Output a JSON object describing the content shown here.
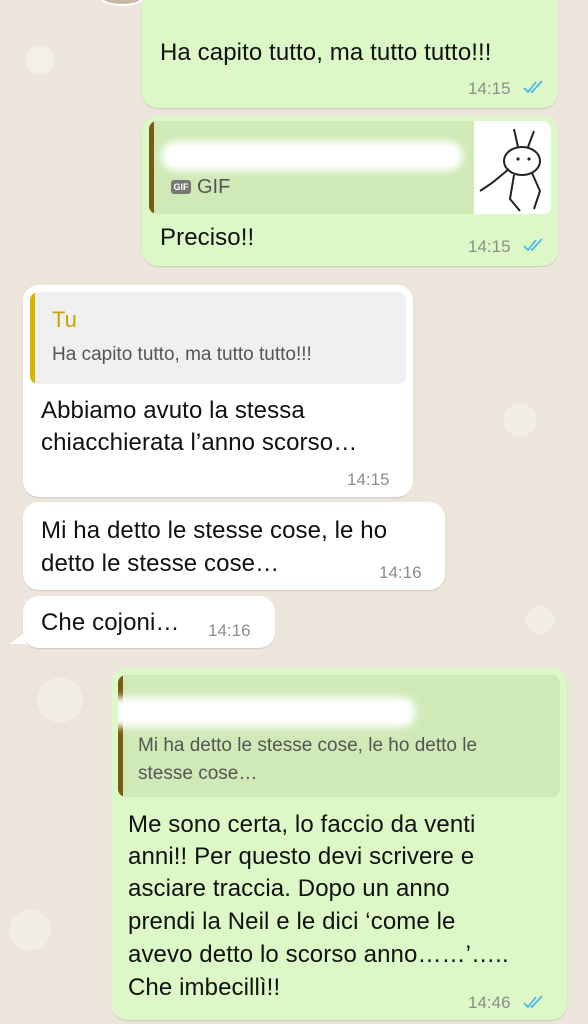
{
  "messages": {
    "m1": {
      "text": "Ha capito tutto, ma tutto tutto!!!",
      "time": "14:15",
      "status": "read"
    },
    "m2": {
      "reply_label": "GIF",
      "gif_badge": "GIF",
      "text": "Preciso!!",
      "time": "14:15",
      "status": "read"
    },
    "m3": {
      "reply_author": "Tu",
      "reply_text": "Ha capito tutto, ma tutto tutto!!!",
      "line1": "Abbiamo avuto la stessa",
      "line2": "chiacchierata l’anno scorso…",
      "time": "14:15"
    },
    "m4": {
      "line1": "Mi ha detto le stesse cose, le ho",
      "line2": "detto le stesse cose…",
      "time": "14:16"
    },
    "m5": {
      "text": "Che cojoni…",
      "time": "14:16"
    },
    "m6": {
      "reply_line1": "Mi ha detto le stesse cose, le ho detto le",
      "reply_line2": "stesse cose…",
      "line1": "Me sono certa, lo faccio da venti",
      "line2": "anni!! Per questo devi scrivere e",
      "line3": "asciare traccia. Dopo un anno",
      "line4": "prendi la Neil e le dici ‘come le",
      "line5": "avevo detto lo scorso anno……’…..",
      "line6": "Che imbecillì!!",
      "time": "14:46",
      "status": "read"
    }
  },
  "colors": {
    "outgoing_bubble": "#dcf8c6",
    "incoming_bubble": "#ffffff",
    "read_ticks": "#4fb6ec",
    "you_author": "#c9a400",
    "reply_bar_out": "#7a5a12",
    "wallpaper": "#ece5dc"
  }
}
